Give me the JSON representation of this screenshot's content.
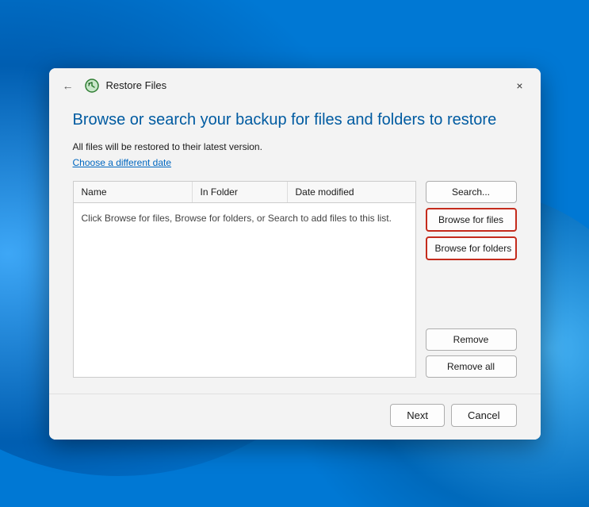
{
  "background": {
    "color": "#0078d4"
  },
  "dialog": {
    "title": "Restore Files",
    "close_label": "×",
    "back_label": "←"
  },
  "page": {
    "heading": "Browse or search your backup for files and folders to restore",
    "info_line": "All files will be restored to their latest version.",
    "choose_date_link": "Choose a different date"
  },
  "table": {
    "columns": [
      "Name",
      "In Folder",
      "Date modified"
    ],
    "empty_message": "Click Browse for files, Browse for folders, or Search to add files to this list."
  },
  "buttons": {
    "search": "Search...",
    "browse_files": "Browse for files",
    "browse_folders": "Browse for folders",
    "remove": "Remove",
    "remove_all": "Remove all"
  },
  "footer": {
    "next": "Next",
    "cancel": "Cancel"
  }
}
